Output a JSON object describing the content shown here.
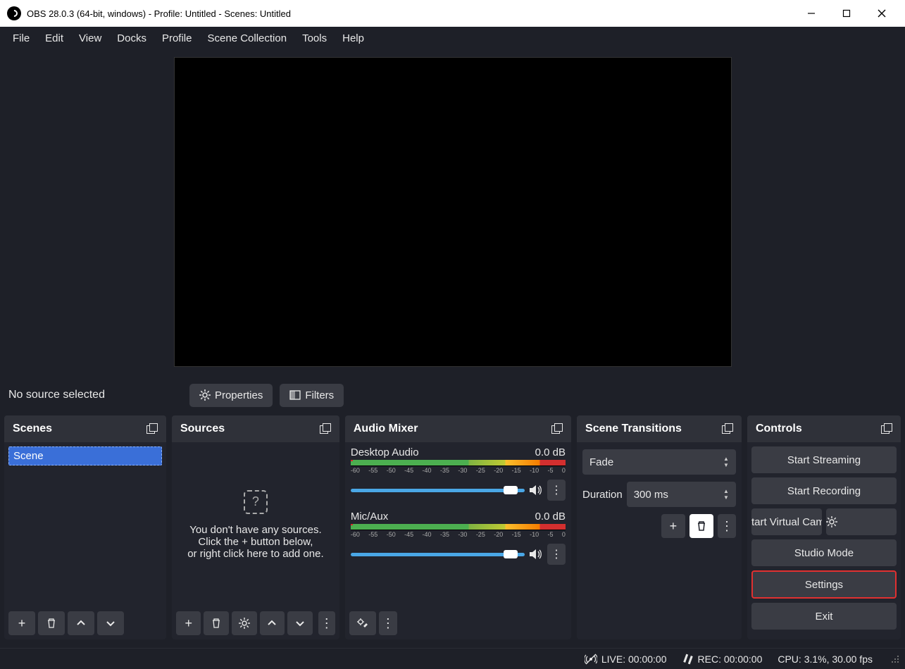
{
  "window": {
    "title": "OBS 28.0.3 (64-bit, windows) - Profile: Untitled - Scenes: Untitled"
  },
  "menus": [
    "File",
    "Edit",
    "View",
    "Docks",
    "Profile",
    "Scene Collection",
    "Tools",
    "Help"
  ],
  "source_toolbar": {
    "no_source": "No source selected",
    "properties": "Properties",
    "filters": "Filters"
  },
  "scenes": {
    "title": "Scenes",
    "items": [
      "Scene"
    ]
  },
  "sources": {
    "title": "Sources",
    "empty_line1": "You don't have any sources.",
    "empty_line2": "Click the + button below,",
    "empty_line3": "or right click here to add one."
  },
  "mixer": {
    "title": "Audio Mixer",
    "channels": {
      "desktop": {
        "name": "Desktop Audio",
        "db": "0.0 dB"
      },
      "mic": {
        "name": "Mic/Aux",
        "db": "0.0 dB"
      }
    },
    "ticks": [
      "-60",
      "-55",
      "-50",
      "-45",
      "-40",
      "-35",
      "-30",
      "-25",
      "-20",
      "-15",
      "-10",
      "-5",
      "0"
    ]
  },
  "transitions": {
    "title": "Scene Transitions",
    "selected": "Fade",
    "duration_label": "Duration",
    "duration_value": "300 ms"
  },
  "controls": {
    "title": "Controls",
    "start_streaming": "Start Streaming",
    "start_recording": "Start Recording",
    "virtual_cam": "tart Virtual Camera",
    "studio_mode": "Studio Mode",
    "settings": "Settings",
    "exit": "Exit"
  },
  "status": {
    "live": "LIVE: 00:00:00",
    "rec": "REC: 00:00:00",
    "cpu": "CPU: 3.1%, 30.00 fps"
  }
}
